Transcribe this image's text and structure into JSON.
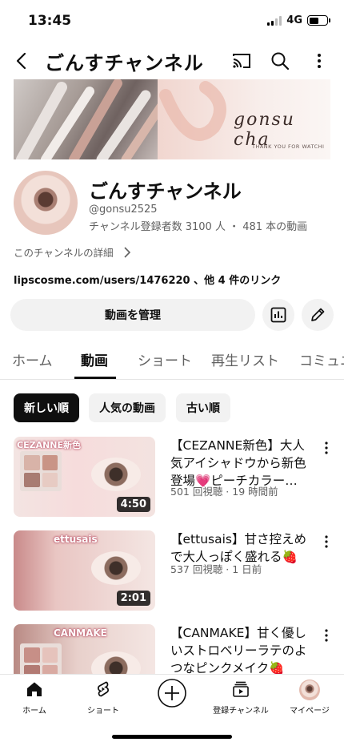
{
  "status_bar": {
    "time": "13:45",
    "network": "4G"
  },
  "header": {
    "title": "ごんすチャンネル"
  },
  "banner": {
    "script_text": "gonsu cha",
    "tagline": "THANK YOU FOR WATCHI"
  },
  "channel": {
    "name": "ごんすチャンネル",
    "handle": "@gonsu2525",
    "stats": "チャンネル登録者数 3100 人 ・ 481 本の動画",
    "details_label": "このチャンネルの詳細",
    "link_text": "lipscosme.com/users/1476220 、他 4 件のリンク"
  },
  "actions": {
    "manage_label": "動画を管理"
  },
  "tabs": [
    "ホーム",
    "動画",
    "ショート",
    "再生リスト",
    "コミュニ"
  ],
  "chips": [
    "新しい順",
    "人気の動画",
    "古い順"
  ],
  "videos": [
    {
      "title": "【CEZANNE新色】大人気アイシャドウから新色登場💗ピーチカラー…",
      "meta": "501 回視聴 · 19 時間前",
      "duration": "4:50",
      "thumb_text": "CEZANNE新色"
    },
    {
      "title": "【ettusais】甘さ控えめで大人っぽく盛れる🍓",
      "meta": "537 回視聴 · 1 日前",
      "duration": "2:01",
      "thumb_text": "ettusais"
    },
    {
      "title": "【CANMAKE】甘く優しいストロベリーラテのよつなピンクメイク🍓",
      "meta": "",
      "duration": "",
      "thumb_text": "CANMAKE"
    }
  ],
  "bottom_nav": {
    "home": "ホーム",
    "shorts": "ショート",
    "subscriptions": "登録チャンネル",
    "mypage": "マイページ"
  }
}
